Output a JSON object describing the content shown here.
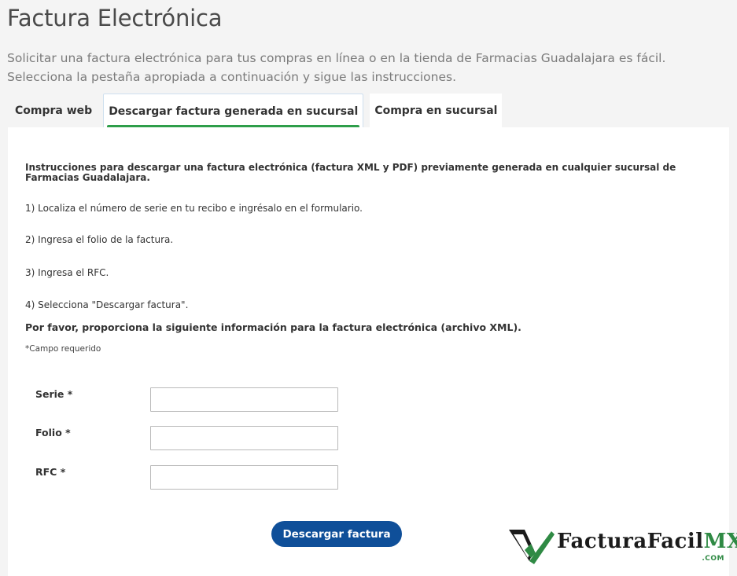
{
  "page": {
    "title": "Factura Electrónica",
    "intro": "Solicitar una factura electrónica para tus compras en línea o en la tienda de Farmacias Guadalajara es fácil. Selecciona la pestaña apropiada a continuación y sigue las instrucciones."
  },
  "tabs": [
    {
      "label": "Compra web",
      "active": false
    },
    {
      "label": "Descargar factura generada en sucursal",
      "active": true
    },
    {
      "label": "Compra en sucursal",
      "active": false
    }
  ],
  "panel": {
    "heading": "Instrucciones para descargar una factura electrónica (factura XML y PDF) previamente generada en cualquier sucursal de Farmacias Guadalajara.",
    "steps": [
      "1) Localiza el número de serie en tu recibo e ingrésalo en el formulario.",
      "2) Ingresa el folio de la factura.",
      "3) Ingresa el RFC.",
      "4) Selecciona \"Descargar factura\"."
    ],
    "provide_info": "Por favor, proporciona la siguiente información para la factura electrónica (archivo XML).",
    "required_note": "*Campo requerido"
  },
  "form": {
    "serie_label": "Serie *",
    "serie_value": "",
    "folio_label": "Folio *",
    "folio_value": "",
    "rfc_label": "RFC *",
    "rfc_value": "",
    "submit_label": "Descargar factura"
  },
  "watermark": {
    "brand": "FacturaFacil",
    "brand_suffix": "MX",
    "domain": ".COM",
    "icon": "checkmark-logo-icon"
  },
  "colors": {
    "tab_active_underline": "#2e9e4a",
    "submit_button": "#0f4f99",
    "brand_green": "#2f8a44"
  }
}
